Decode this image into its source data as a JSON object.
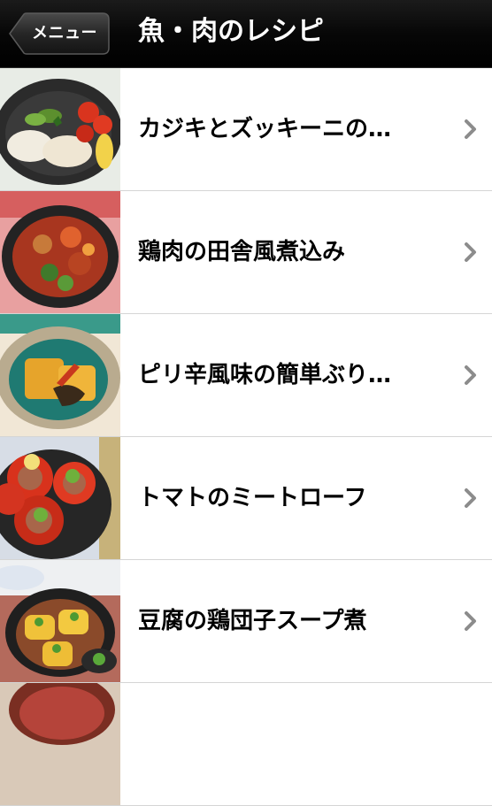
{
  "navbar": {
    "back_label": "メニュー",
    "title": "魚・肉のレシピ"
  },
  "recipes": [
    {
      "title": "カジキとズッキーニの…",
      "thumb_icon": "swordfish-zucchini-dish-photo"
    },
    {
      "title": "鶏肉の田舎風煮込み",
      "thumb_icon": "country-style-chicken-stew-photo"
    },
    {
      "title": "ピリ辛風味の簡単ぶり…",
      "thumb_icon": "spicy-yellowtail-radish-photo"
    },
    {
      "title": "トマトのミートローフ",
      "thumb_icon": "tomato-meatloaf-photo"
    },
    {
      "title": "豆腐の鶏団子スープ煮",
      "thumb_icon": "tofu-chicken-meatball-soup-photo"
    },
    {
      "title": "",
      "thumb_icon": "partial-dish-photo"
    }
  ],
  "colors": {
    "navbar": "#000000",
    "separator": "#d5d5d5",
    "chevron": "#8c8c8c",
    "text": "#000000"
  }
}
